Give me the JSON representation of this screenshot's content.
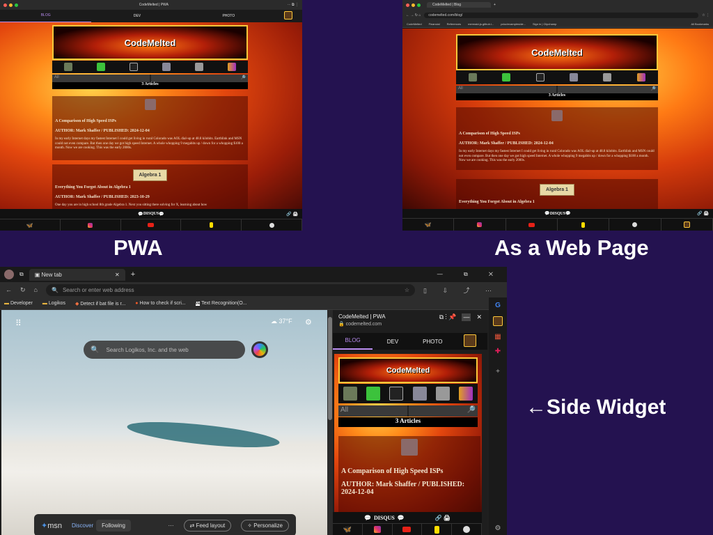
{
  "pwa": {
    "window_title": "CodeMelted | PWA",
    "tabs": [
      "BLOG",
      "DEV",
      "PHOTO"
    ],
    "logo_text": "CodeMelted",
    "filter_value": "All",
    "article_count": "3 Articles",
    "articles": [
      {
        "title": "A Comparison of High Speed ISPs",
        "meta": "AUTHOR: Mark Shaffer / PUBLISHED: 2024-12-04",
        "body": "In my early Internet days my fastest Internet I could get living in rural Colorado was AOL dial-up at 48.8 kilobits. Earthlink and MSN could not even compare. But then one day we got high speed Internet. A whole whopping 9 megabits up / down for a whopping $100 a month. Now we are cooking. This was the early 2000s."
      },
      {
        "title": "Everything You Forgot About in Algebra 1",
        "meta": "AUTHOR: Mark Shaffer / PUBLISHED: 2023-10-29",
        "thumb_label": "Algebra 1",
        "body": "One day you are in high school 8th grade Algebra 1. Next you sitting there solving for X, learning about how"
      }
    ],
    "disqus": "DISQUS",
    "caption": "PWA"
  },
  "web": {
    "tab_title": "CodeMelted | Blog",
    "url": "codemelted.com/blog/",
    "bookmarks": [
      "CodeMelted",
      "Financial",
      "References",
      "mermaid-js.github.i...",
      "pdoc/examples/de...",
      "Sign in | Clipchamp"
    ],
    "all_bookmarks": "All Bookmarks",
    "logo_text": "CodeMelted",
    "filter_value": "All",
    "article_count": "3 Articles",
    "articles": [
      {
        "title": "A Comparison of High Speed ISPs",
        "meta": "AUTHOR: Mark Shaffer / PUBLISHED: 2024-12-04",
        "body": "In my early Internet days my fastest Internet I could get living in rural Colorado was AOL dial-up at 48.8 kilobits. Earthlink and MSN could not even compare. But then one day we got high speed Internet. A whole whopping 9 megabits up / down for a whopping $100 a month. Now we are cooking. This was the early 2000s."
      },
      {
        "title": "Everything You Forgot About in Algebra 1",
        "thumb_label": "Algebra 1"
      }
    ],
    "disqus": "DISQUS",
    "caption": "As a Web Page"
  },
  "edge": {
    "tab_title": "New tab",
    "address_placeholder": "Search or enter web address",
    "favorites": [
      "Developer",
      "Logikos",
      "Detect if bat file is r...",
      "How to check if scri...",
      "Text Recognition(O..."
    ],
    "weather": "37°F",
    "search_placeholder": "Search Logikos, Inc. and the web",
    "msn_logo": "msn",
    "msn_tabs": [
      "Discover",
      "Following"
    ],
    "more": "···",
    "feed_layout": "Feed layout",
    "personalize": "Personalize"
  },
  "widget": {
    "title": "CodeMelted | PWA",
    "domain": "codemelted.com",
    "tabs": [
      "BLOG",
      "DEV",
      "PHOTO"
    ],
    "logo_text": "CodeMelted",
    "filter_value": "All",
    "article_count": "3 Articles",
    "article_title": "A Comparison of High Speed ISPs",
    "article_meta": "AUTHOR: Mark Shaffer / PUBLISHED: 2024-12-04",
    "disqus": "DISQUS",
    "caption": "←Side Widget"
  },
  "colors": {
    "background": "#241250",
    "accent_yellow": "#ffc83a",
    "tab_active": "#b98cf0"
  }
}
